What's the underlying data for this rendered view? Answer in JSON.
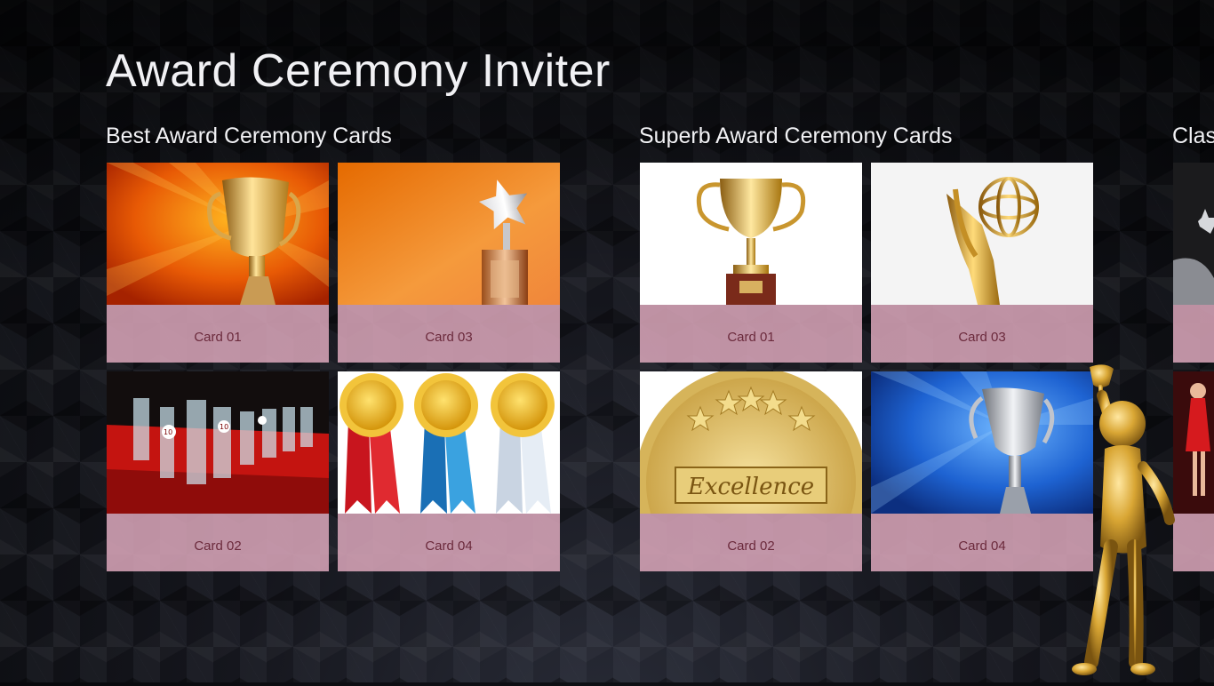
{
  "app": {
    "title": "Award Ceremony Inviter"
  },
  "groups": [
    {
      "title": "Best Award Ceremony Cards",
      "cards": [
        {
          "label": "Card 01",
          "image": "gold-trophy-orange-rays"
        },
        {
          "label": "Card 03",
          "image": "star-trophy-orange"
        },
        {
          "label": "Card 02",
          "image": "glass-awards-red-table"
        },
        {
          "label": "Card 04",
          "image": "ribbon-rosettes"
        }
      ]
    },
    {
      "title": "Superb Award Ceremony Cards",
      "cards": [
        {
          "label": "Card 01",
          "image": "gold-cup-white"
        },
        {
          "label": "Card 03",
          "image": "emmy-statue"
        },
        {
          "label": "Card 02",
          "image": "excellence-seal"
        },
        {
          "label": "Card 04",
          "image": "silver-trophy-blue-rays"
        }
      ]
    },
    {
      "title": "Clas",
      "cards": []
    }
  ],
  "colors": {
    "card_label_bg": "#dda8bc",
    "card_label_text": "#6b2a3c",
    "title_text": "#f1f1f4"
  }
}
